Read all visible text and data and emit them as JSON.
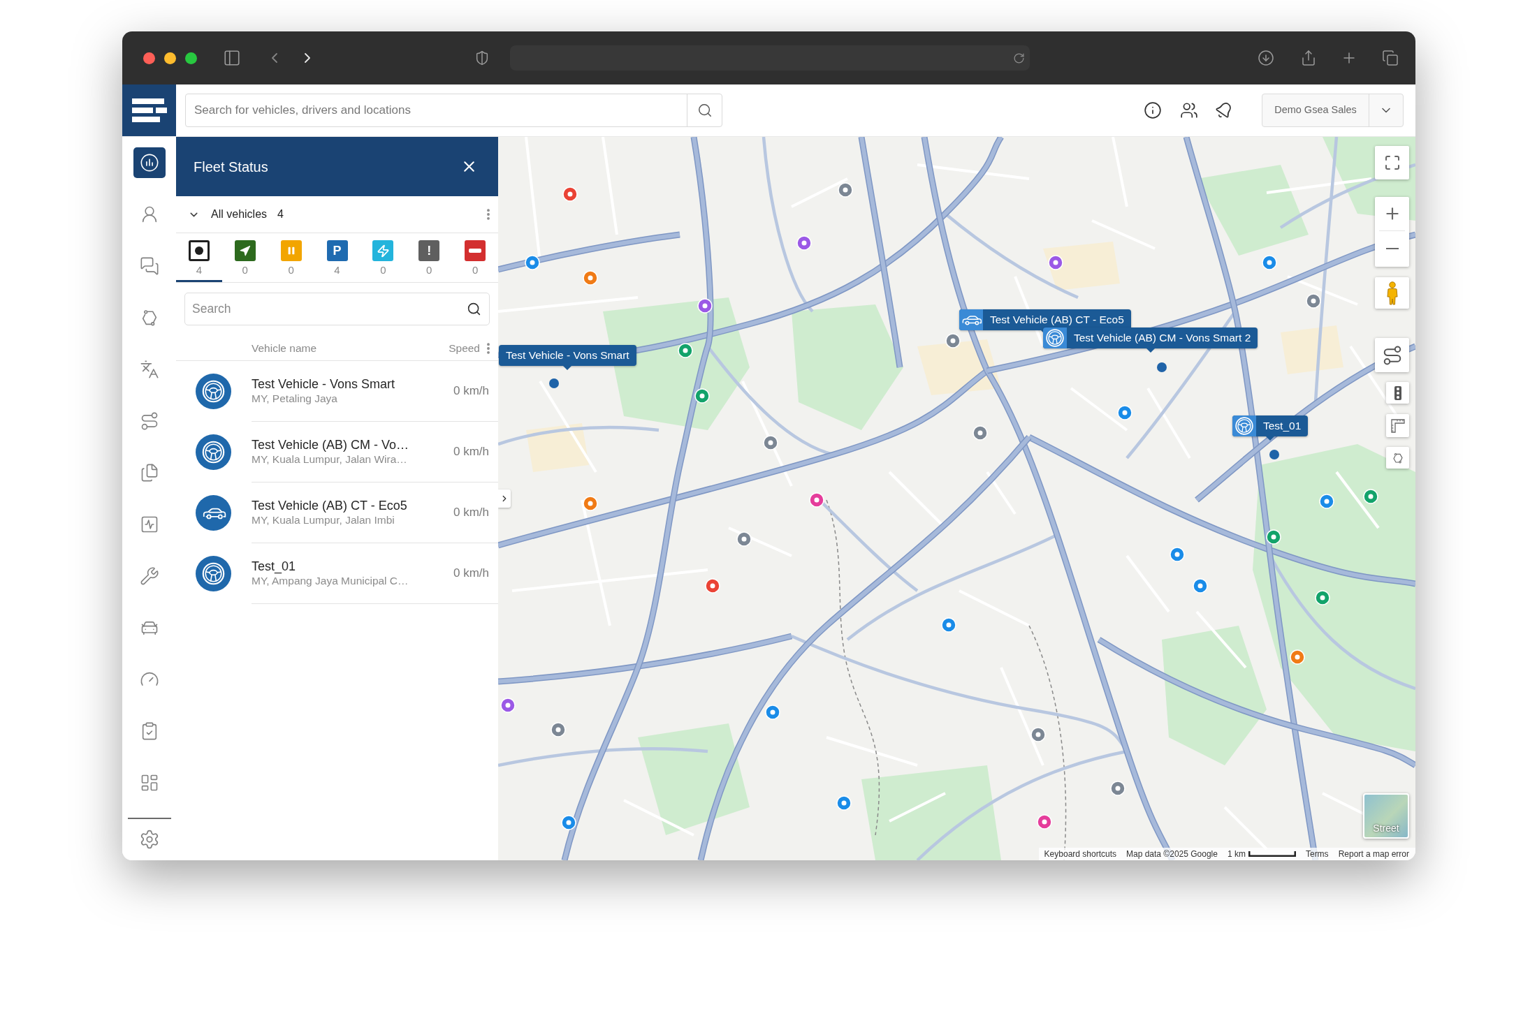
{
  "header": {
    "search": {
      "placeholder": "Search for vehicles, drivers and locations"
    },
    "account": {
      "label": "Demo Gsea Sales"
    }
  },
  "sidebar": {
    "items": [
      {
        "selected": true
      },
      {
        "selected": false
      },
      {
        "selected": false
      },
      {
        "selected": false
      },
      {
        "selected": false
      },
      {
        "selected": false
      },
      {
        "selected": false
      },
      {
        "selected": false
      },
      {
        "selected": false
      },
      {
        "selected": false
      },
      {
        "selected": false
      },
      {
        "selected": false
      },
      {
        "selected": false
      }
    ]
  },
  "fleet_panel": {
    "title": "Fleet Status",
    "group": {
      "label": "All vehicles",
      "count": "4",
      "expanded": true
    },
    "status_filters": [
      {
        "count": "4",
        "color": "#1f1f1f",
        "selected": true
      },
      {
        "count": "0",
        "color": "#2d6a1e",
        "selected": false
      },
      {
        "count": "0",
        "color": "#f2a500",
        "selected": false
      },
      {
        "symbol": "P",
        "count": "4",
        "color": "#1f6bb0",
        "selected": false
      },
      {
        "count": "0",
        "color": "#23b4dc",
        "selected": false
      },
      {
        "symbol": "!",
        "count": "0",
        "color": "#5f5f5f",
        "selected": false
      },
      {
        "count": "0",
        "color": "#d32f2f",
        "selected": false
      }
    ],
    "search": {
      "placeholder": "Search"
    },
    "columns": [
      "Vehicle name",
      "Speed"
    ],
    "vehicles": [
      {
        "kind": "wheel",
        "name": "Test Vehicle - Vons Smart",
        "location": "MY, Petaling Jaya",
        "speed": "0 km/h"
      },
      {
        "kind": "wheel",
        "name": "Test Vehicle (AB) CM - Vo…",
        "location": "MY, Kuala Lumpur, Jalan Wira…",
        "speed": "0 km/h"
      },
      {
        "kind": "car",
        "name": "Test Vehicle (AB) CT - Eco5",
        "location": "MY, Kuala Lumpur, Jalan Imbi",
        "speed": "0 km/h"
      },
      {
        "kind": "wheel",
        "name": "Test_01",
        "location": "MY, Ampang Jaya Municipal C…",
        "speed": "0 km/h"
      }
    ]
  },
  "map": {
    "vehicle_labels": [
      {
        "kind": "plain",
        "name": "Test Vehicle - Vons Smart"
      },
      {
        "kind": "car",
        "name": "Test Vehicle (AB) CT - Eco5"
      },
      {
        "kind": "wheel",
        "name": "Test Vehicle (AB) CM - Vons Smart 2"
      },
      {
        "kind": "wheel",
        "name": "Test_01"
      }
    ],
    "map_type": {
      "label": "Street"
    },
    "footer": {
      "shortcuts": "Keyboard shortcuts",
      "attribution": "Map data ©2025 Google",
      "scale": "1 km",
      "terms": "Terms",
      "report": "Report a map error"
    }
  }
}
